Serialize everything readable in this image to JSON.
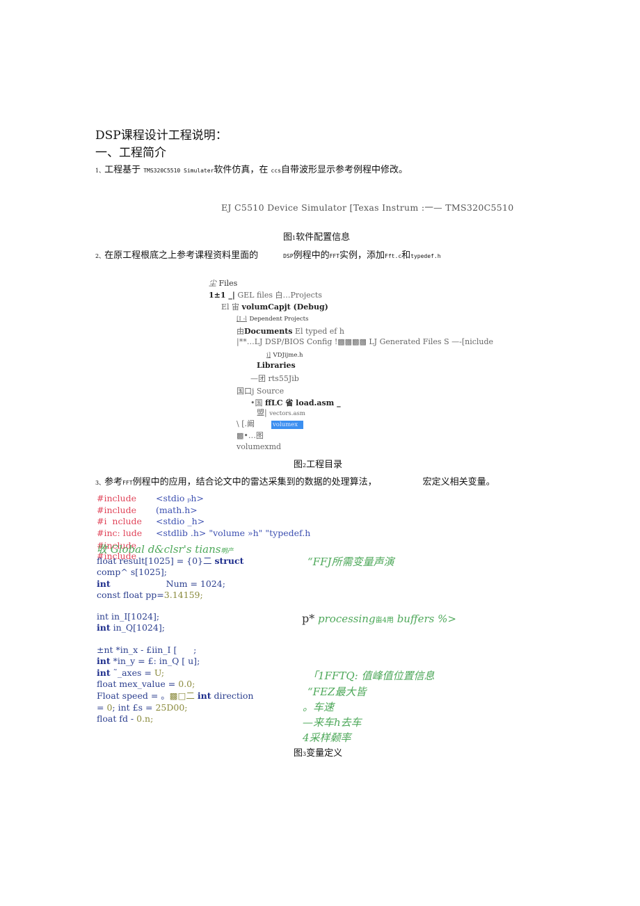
{
  "document": {
    "title": "DSP课程设计工程说明：",
    "section1": "一、工程简介",
    "item1": {
      "num": "1、",
      "text_a": "工程基于 ",
      "chip": "TMS320C5510 Simulater",
      "text_b": "软件仿真，在 ",
      "ccs": "ccs",
      "text_c": "自带波形显示参考例程中修改。"
    },
    "figure1": {
      "simulator_line": "EJ C5510 Device Simulator [Texas Instrum :一— TMS320C5510",
      "caption_prefix": "图",
      "caption_num": "1",
      "caption_text": "软件配置信息"
    },
    "item2": {
      "num": "2、",
      "text_a": "在原工程根底之上参考课程资料里面的",
      "dsp": "DSP",
      "text_b": "例程中的",
      "fft": "FFT",
      "text_c": "实例，添加",
      "file1": "Fft.c",
      "text_d": "和",
      "file2": "typedef.h"
    },
    "figure2": {
      "tree": [
        {
          "glyph": "尘",
          "label": "Files"
        },
        {
          "glyph": "1±1 _|",
          "label": "GEL files 白…Projects"
        },
        {
          "glyph": "El 宙",
          "label": "volumCapjt (Debug)"
        },
        {
          "glyph": "[I -l",
          "label": "Dependent Projects"
        },
        {
          "glyph": "由",
          "label": "Documents",
          "extra": "El typed ef h"
        },
        {
          "glyph": "|**…",
          "label": "LJ DSP/BIOS Config !▩▩▩▩ LJ Generated Files S —-[niclude"
        },
        {
          "glyph": "i]",
          "label": "VDJijme.h"
        },
        {
          "glyph": "",
          "label": "Libraries"
        },
        {
          "glyph": "—团",
          "label": "rts55Jib"
        },
        {
          "glyph": "国口j",
          "label": "Source"
        },
        {
          "glyph": "•国",
          "label": "ffLC 省 load.asm _"
        },
        {
          "glyph": "盟|",
          "label": "vectors.asm"
        },
        {
          "glyph": "\\ [.阚",
          "label": "volumex"
        },
        {
          "glyph": "▩•…图",
          "label": ""
        },
        {
          "glyph": "",
          "label": "volumexmd"
        }
      ],
      "caption_prefix": "图",
      "caption_num": "2",
      "caption_text": "工程目录"
    },
    "item3": {
      "num": "3、",
      "text_a": "参考",
      "fft": "FFT",
      "text_b": "例程中的应用，结合论文中的雷达采集到的数据的处理算法，",
      "text_c": "宏定义相关变量。"
    },
    "code": {
      "includes": [
        {
          "directive": "#include",
          "header": "<stdio ₚh>"
        },
        {
          "directive": "#include",
          "header": "(math.h>"
        },
        {
          "directive": "#i  nclude",
          "header": "<stdio _h>"
        },
        {
          "directive": "#inc: lude",
          "header": "<stdlib .h>",
          "extra": "\"volume »h\" \"typedef.h"
        }
      ],
      "overlap_include_1": "#include",
      "overlap_include_2": "#include",
      "global_comment": "收 Global d&clsr's tians",
      "global_comment_tail": "明产",
      "result_line_a": "float result[1025] = {0}二 ",
      "result_kw": "struct",
      "comp_line": "comp^ s[1025];",
      "num_kw": "int",
      "num_line": "Num = 1024;",
      "pp_line_a": "const float pp=",
      "pp_val": "3.14159;",
      "in_i": "int in_I[1024];",
      "in_q_kw": "int",
      "in_q": " in_Q[1024];",
      "in_x": "±nt *in_x - £iin_I [      ;",
      "in_y_kw": "int",
      "in_y": " *in_y = £: in_Q [ u];",
      "axes_kw": "int",
      "axes": " ˜_axes = ",
      "axes_val": "U;",
      "mex": "float mex_value = ",
      "mex_val": "0.0;",
      "speed_a": "Float speed = 。",
      "speed_b": "▩□二 ",
      "speed_kw": "int",
      "speed_c": " direction",
      "fs_a": "= ",
      "fs_val0": "0",
      "fs_b": "; int £s = ",
      "fs_val": "25D00;",
      "fd_a": "float fd - ",
      "fd_val": "0.n;"
    },
    "comments": {
      "fft_vars": "“FFJ所需变量声演",
      "proc_prefix": "p*",
      "processing": " processing",
      "proc_mid": "亩4用",
      "buffers": " buffers %>",
      "peak": "「1FFTQ: 值峰值位置信息",
      "fez": "“FEZ最大皆",
      "speed": "。车速",
      "direction": "—来车h去车",
      "sample": "4采样颡率"
    },
    "figure3": {
      "caption_prefix": "图",
      "caption_num": "3",
      "caption_text": "变量定义"
    }
  }
}
